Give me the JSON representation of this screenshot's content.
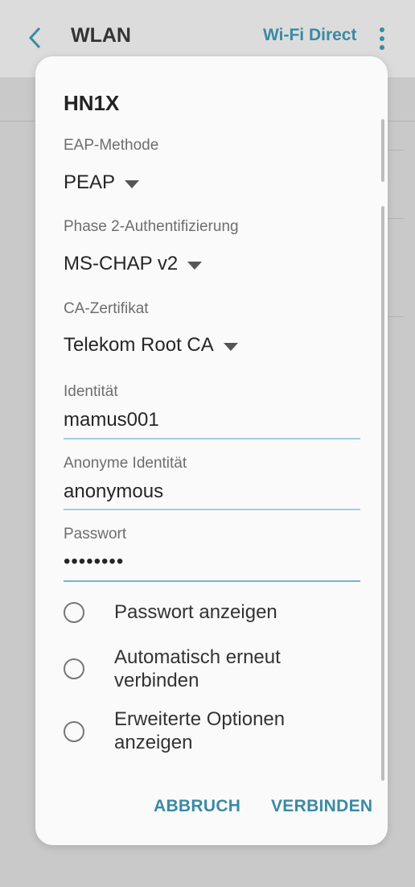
{
  "appbar": {
    "title": "WLAN",
    "wifi_direct": "Wi-Fi Direct"
  },
  "dialog": {
    "network_name": "HN1X",
    "eap_method": {
      "label": "EAP-Methode",
      "value": "PEAP"
    },
    "phase2": {
      "label": "Phase 2-Authentifizierung",
      "value": "MS-CHAP v2"
    },
    "ca_cert": {
      "label": "CA-Zertifikat",
      "value": "Telekom Root CA"
    },
    "identity": {
      "label": "Identität",
      "value": "mamus001"
    },
    "anon_identity": {
      "label": "Anonyme Identität",
      "value": "anonymous"
    },
    "password": {
      "label": "Passwort",
      "value": "••••••••"
    },
    "options": [
      {
        "line1": "Passwort anzeigen",
        "line2": ""
      },
      {
        "line1": "Automatisch erneut",
        "line2": "verbinden"
      },
      {
        "line1": "Erweiterte Optionen",
        "line2": "anzeigen"
      }
    ],
    "cancel_label": "ABBRUCH",
    "connect_label": "VERBINDEN"
  }
}
